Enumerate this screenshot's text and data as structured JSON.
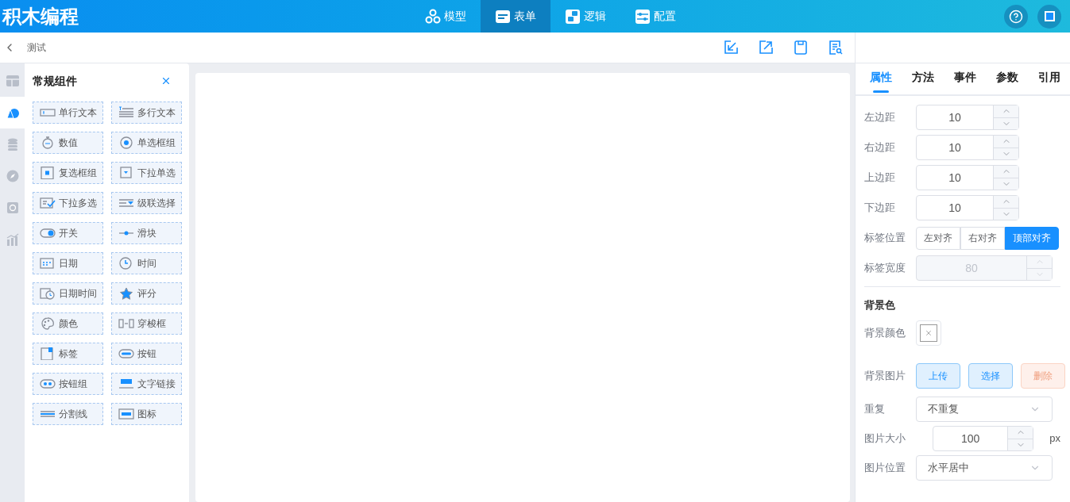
{
  "app": {
    "title": "积木编程"
  },
  "nav": [
    {
      "label": "模型",
      "kind": "model",
      "selected": false
    },
    {
      "label": "表单",
      "kind": "form",
      "selected": true
    },
    {
      "label": "逻辑",
      "kind": "logic",
      "selected": false
    },
    {
      "label": "配置",
      "kind": "config",
      "selected": false
    }
  ],
  "breadcrumb": {
    "title": "测试"
  },
  "rail": [
    {
      "kind": "layout",
      "selected": false
    },
    {
      "kind": "widget",
      "selected": true
    },
    {
      "kind": "data",
      "selected": false
    },
    {
      "kind": "compass",
      "selected": false
    },
    {
      "kind": "media",
      "selected": false
    },
    {
      "kind": "chart",
      "selected": false
    }
  ],
  "palette": {
    "title": "常规组件",
    "items": [
      {
        "label": "单行文本",
        "kind": "input"
      },
      {
        "label": "多行文本",
        "kind": "textarea"
      },
      {
        "label": "数值",
        "kind": "number"
      },
      {
        "label": "单选框组",
        "kind": "radio"
      },
      {
        "label": "复选框组",
        "kind": "checkbox"
      },
      {
        "label": "下拉单选",
        "kind": "select"
      },
      {
        "label": "下拉多选",
        "kind": "multiselect"
      },
      {
        "label": "级联选择",
        "kind": "cascader"
      },
      {
        "label": "开关",
        "kind": "switch"
      },
      {
        "label": "滑块",
        "kind": "slider"
      },
      {
        "label": "日期",
        "kind": "date"
      },
      {
        "label": "时间",
        "kind": "time"
      },
      {
        "label": "日期时间",
        "kind": "datetime"
      },
      {
        "label": "评分",
        "kind": "rate"
      },
      {
        "label": "颜色",
        "kind": "color"
      },
      {
        "label": "穿梭框",
        "kind": "transfer"
      },
      {
        "label": "标签",
        "kind": "tag"
      },
      {
        "label": "按钮",
        "kind": "button"
      },
      {
        "label": "按钮组",
        "kind": "buttongroup"
      },
      {
        "label": "文字链接",
        "kind": "link"
      },
      {
        "label": "分割线",
        "kind": "divider"
      },
      {
        "label": "图标",
        "kind": "icon"
      }
    ]
  },
  "props": {
    "tabs": [
      {
        "label": "属性",
        "selected": true
      },
      {
        "label": "方法",
        "selected": false
      },
      {
        "label": "事件",
        "selected": false
      },
      {
        "label": "参数",
        "selected": false
      },
      {
        "label": "引用",
        "selected": false
      }
    ],
    "fields": [
      {
        "kind": "number",
        "label": "左边距",
        "value": "10",
        "disabled": false
      },
      {
        "kind": "number",
        "label": "右边距",
        "value": "10",
        "disabled": false
      },
      {
        "kind": "number",
        "label": "上边距",
        "value": "10",
        "disabled": false
      },
      {
        "kind": "number",
        "label": "下边距",
        "value": "10",
        "disabled": false
      },
      {
        "kind": "segmented",
        "label": "标签位置",
        "options": [
          {
            "label": "左对齐",
            "selected": false
          },
          {
            "label": "右对齐",
            "selected": false
          },
          {
            "label": "顶部对齐",
            "selected": true
          }
        ]
      },
      {
        "kind": "number",
        "label": "标签宽度",
        "value": "80",
        "disabled": true
      },
      {
        "kind": "section",
        "label": "背景色"
      },
      {
        "kind": "color",
        "label": "背景颜色"
      },
      {
        "kind": "buttons",
        "label": "背景图片",
        "buttons": [
          {
            "label": "上传",
            "kind": "primary"
          },
          {
            "label": "选择",
            "kind": "primary"
          },
          {
            "label": "删除",
            "kind": "danger"
          }
        ]
      },
      {
        "kind": "select",
        "label": "重复",
        "value": "不重复"
      },
      {
        "kind": "number",
        "label": "图片大小",
        "value": "100",
        "unit": "px",
        "disabled": false
      },
      {
        "kind": "select",
        "label": "图片位置",
        "value": "水平居中"
      }
    ]
  }
}
